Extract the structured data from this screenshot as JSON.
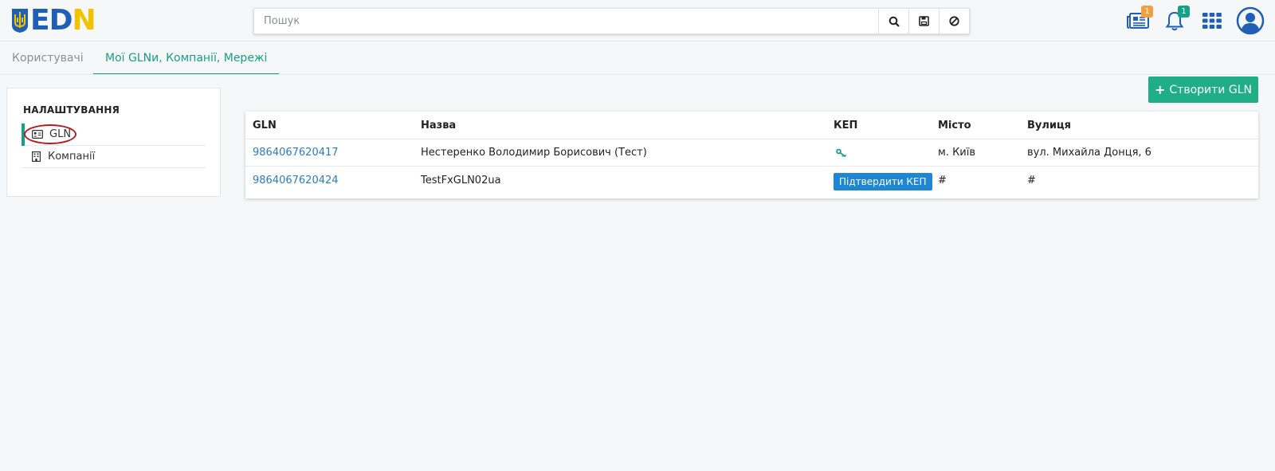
{
  "header": {
    "logo_text_blue": "ED",
    "logo_text_yellow": "N",
    "search_placeholder": "Пошук",
    "news_badge": "1",
    "notifications_badge": "1",
    "colors": {
      "brand_blue": "#1f5fb5",
      "brand_yellow": "#f4c300",
      "badge_orange": "#f0a040",
      "badge_green": "#16a085"
    }
  },
  "tabs": [
    {
      "label": "Користувачі",
      "active": false
    },
    {
      "label": "Мої GLNи, Компанії, Мережі",
      "active": true
    }
  ],
  "sidebar": {
    "title": "НАЛАШТУВАННЯ",
    "items": [
      {
        "label": "GLN",
        "icon": "id-card-icon",
        "active": true
      },
      {
        "label": "Компанії",
        "icon": "building-icon",
        "active": false
      }
    ]
  },
  "create_button": {
    "label": "Створити GLN"
  },
  "table": {
    "columns": [
      "GLN",
      "Назва",
      "КЕП",
      "Місто",
      "Вулиця"
    ],
    "rows": [
      {
        "gln": "9864067620417",
        "name": "Нестеренко Володимир Борисович (Тест)",
        "kep": "key-icon",
        "city": "м. Київ",
        "street": "вул. Михайла Донця, 6"
      },
      {
        "gln": "9864067620424",
        "name": "TestFxGLN02ua",
        "kep_button": "Підтвердити КЕП",
        "city": "#",
        "street": "#"
      }
    ]
  }
}
